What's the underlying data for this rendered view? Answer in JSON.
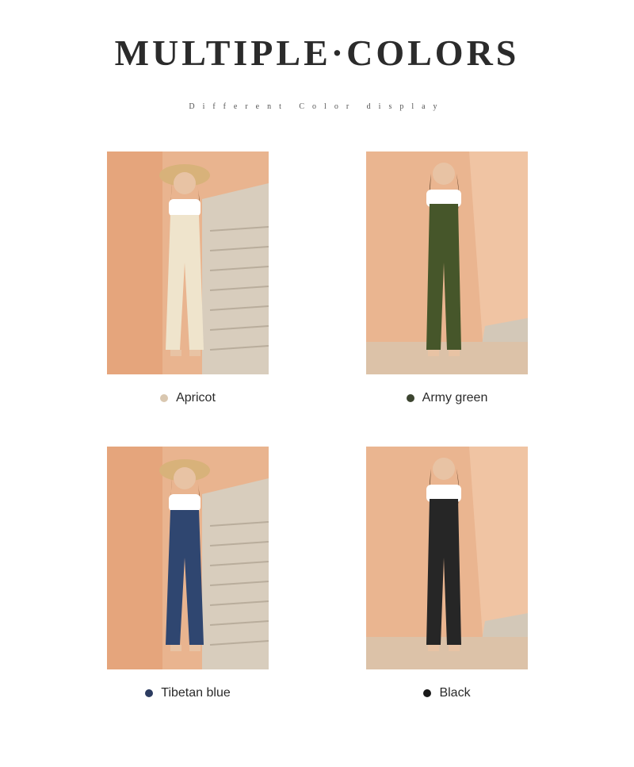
{
  "header": {
    "title": "MULTIPLE·COLORS",
    "subtitle": "Different Color display"
  },
  "variants": [
    {
      "label": "Apricot",
      "swatch": "#d9c7b0",
      "garment": "#efe4cc",
      "pose": "hat-left"
    },
    {
      "label": "Army green",
      "swatch": "#3c4530",
      "garment": "#46562a",
      "pose": "standing"
    },
    {
      "label": "Tibetan blue",
      "swatch": "#2c3c60",
      "garment": "#2f4670",
      "pose": "hat-left"
    },
    {
      "label": "Black",
      "swatch": "#1a1a1a",
      "garment": "#262626",
      "pose": "standing"
    }
  ]
}
